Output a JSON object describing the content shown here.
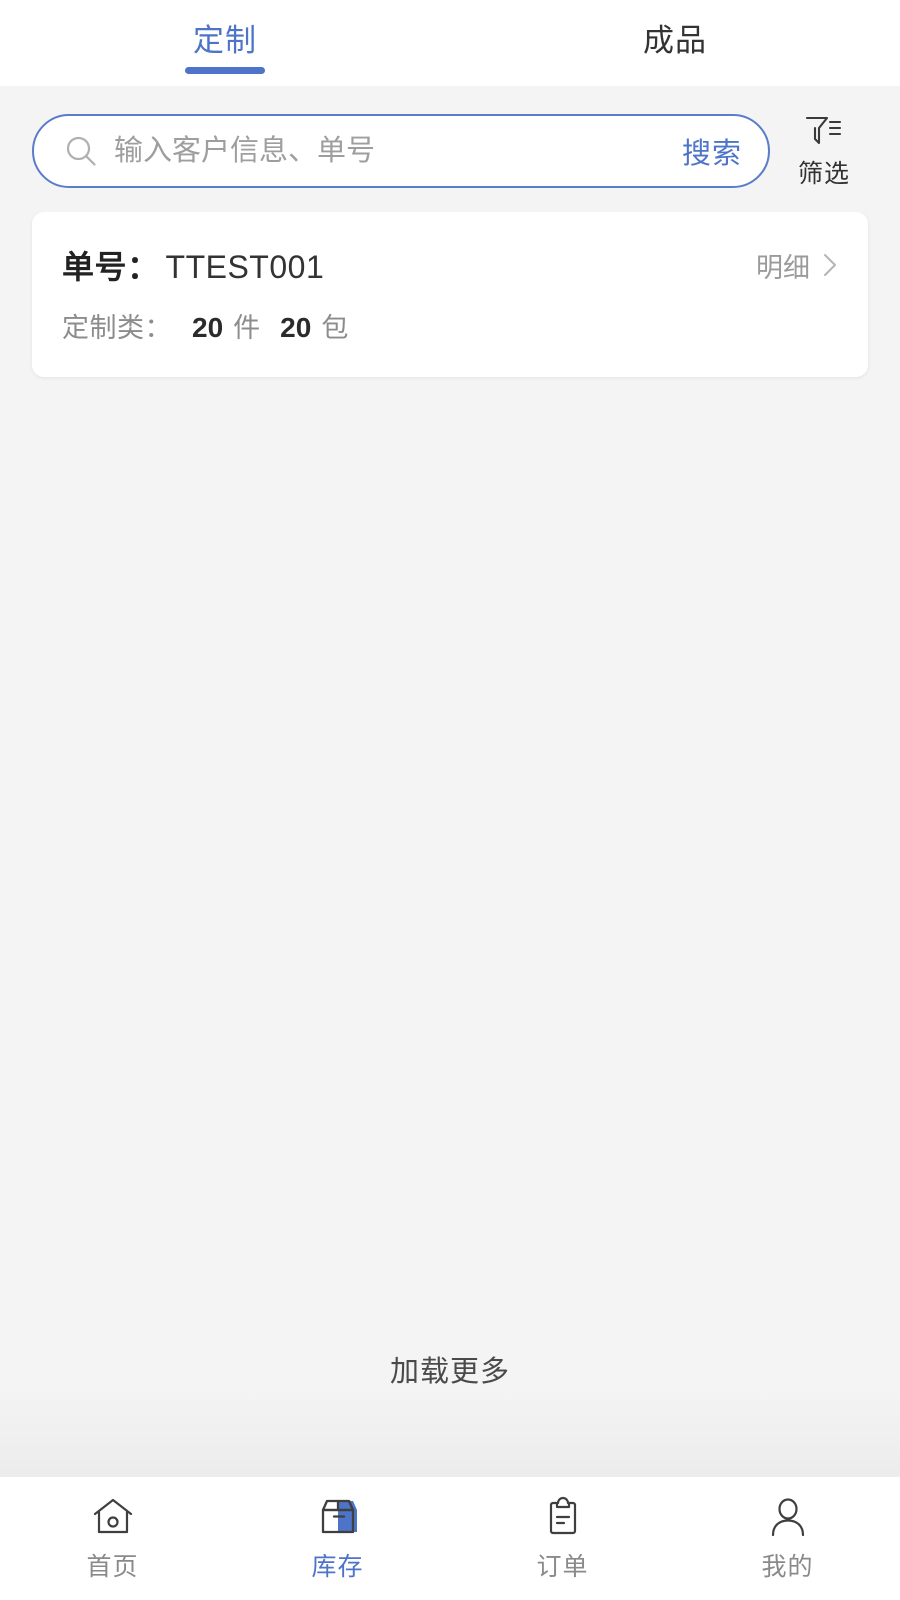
{
  "theme": {
    "accent": "#4d74c8",
    "border_accent": "#5b7cc9",
    "page_bg": "#f4f4f4",
    "card_bg": "#ffffff",
    "text_primary": "#333333",
    "text_muted": "#8c8c8c"
  },
  "tabs": [
    {
      "label": "定制",
      "active": true
    },
    {
      "label": "成品",
      "active": false
    }
  ],
  "search": {
    "icon": "search-icon",
    "placeholder": "输入客户信息、单号",
    "value": "",
    "submit_label": "搜索"
  },
  "filter": {
    "icon": "filter-icon",
    "label": "筛选"
  },
  "list": {
    "items": [
      {
        "order_label": "单号：",
        "order_value": "TTEST001",
        "detail_label": "明细",
        "detail_chevron": "chevron-right-icon",
        "category_label": "定制类：",
        "pieces_count": "20",
        "pieces_unit": "件",
        "packages_count": "20",
        "packages_unit": "包"
      }
    ],
    "load_more_label": "加载更多"
  },
  "bottom_nav": {
    "items": [
      {
        "label": "首页",
        "icon": "home-icon",
        "active": false
      },
      {
        "label": "库存",
        "icon": "box-icon",
        "active": true
      },
      {
        "label": "订单",
        "icon": "clipboard-icon",
        "active": false
      },
      {
        "label": "我的",
        "icon": "person-icon",
        "active": false
      }
    ]
  }
}
